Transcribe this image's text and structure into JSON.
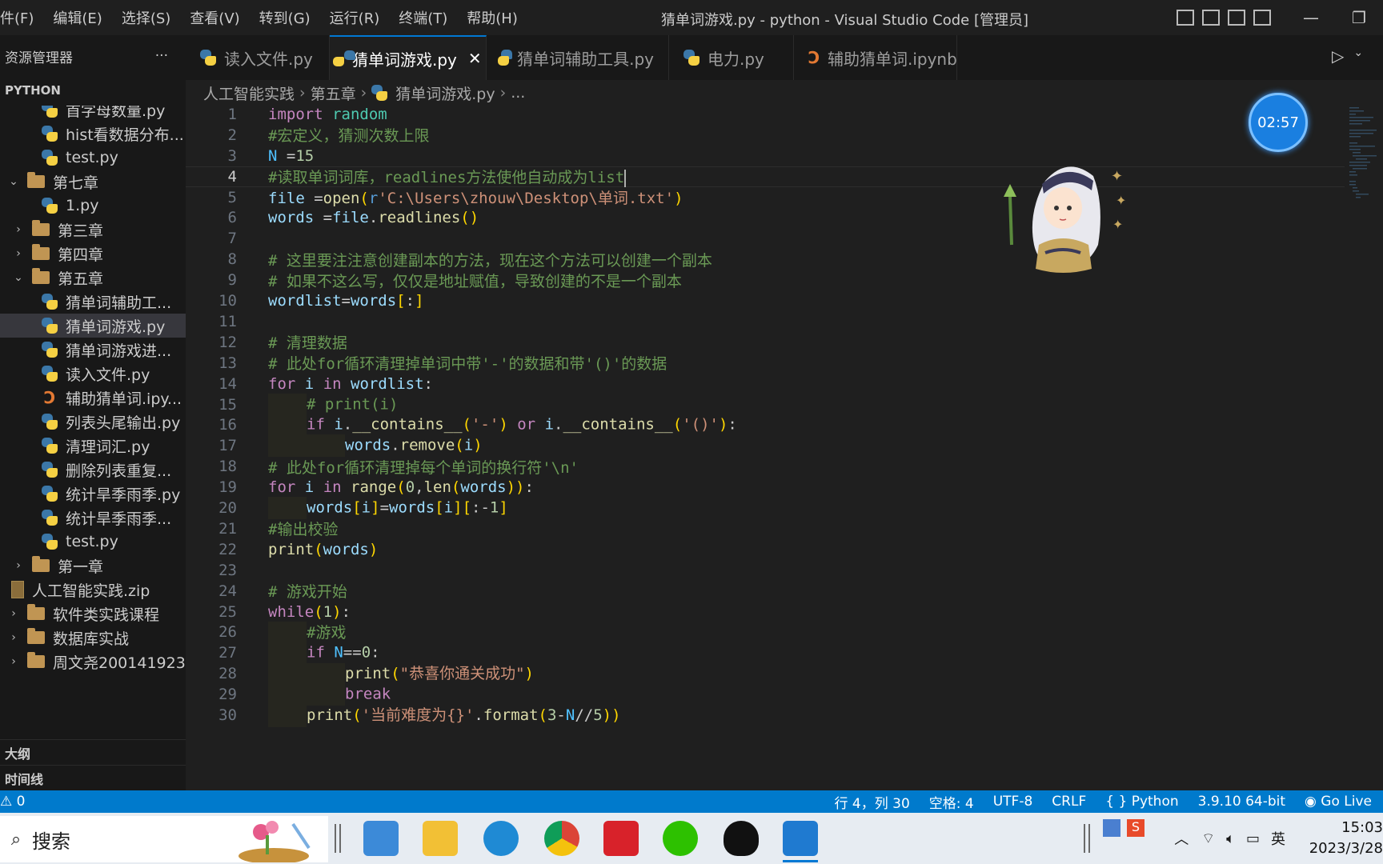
{
  "titlebar": {
    "menus": [
      "件(F)",
      "编辑(E)",
      "选择(S)",
      "查看(V)",
      "转到(G)",
      "运行(R)",
      "终端(T)",
      "帮助(H)"
    ],
    "title": "猜单词游戏.py - python - Visual Studio Code [管理员]"
  },
  "sidebar": {
    "header": "资源管理器",
    "more": "···",
    "section": "PYTHON",
    "items": [
      {
        "label": "首字母数量.py",
        "type": "py"
      },
      {
        "label": "hist看数据分布...",
        "type": "py"
      },
      {
        "label": "test.py",
        "type": "py"
      },
      {
        "label": "第七章",
        "type": "folder",
        "open": true
      },
      {
        "label": "1.py",
        "type": "py"
      },
      {
        "label": "第三章",
        "type": "folder"
      },
      {
        "label": "第四章",
        "type": "folder"
      },
      {
        "label": "第五章",
        "type": "folder",
        "open": true
      },
      {
        "label": "猜单词辅助工...",
        "type": "py"
      },
      {
        "label": "猜单词游戏.py",
        "type": "py",
        "selected": true
      },
      {
        "label": "猜单词游戏进...",
        "type": "py"
      },
      {
        "label": "读入文件.py",
        "type": "py"
      },
      {
        "label": "辅助猜单词.ipy...",
        "type": "nb"
      },
      {
        "label": "列表头尾输出.py",
        "type": "py"
      },
      {
        "label": "清理词汇.py",
        "type": "py"
      },
      {
        "label": "删除列表重复...",
        "type": "py"
      },
      {
        "label": "统计旱季雨季.py",
        "type": "py"
      },
      {
        "label": "统计旱季雨季...",
        "type": "py"
      },
      {
        "label": "test.py",
        "type": "py"
      },
      {
        "label": "第一章",
        "type": "folder"
      },
      {
        "label": "人工智能实践.zip",
        "type": "zip"
      },
      {
        "label": "软件类实践课程",
        "type": "folder"
      },
      {
        "label": "数据库实战",
        "type": "folder"
      },
      {
        "label": "周文尧200141923",
        "type": "folder"
      }
    ],
    "outline": "大纲",
    "timeline": "时间线"
  },
  "tabs": [
    {
      "label": "读入文件.py",
      "type": "py"
    },
    {
      "label": "猜单词游戏.py",
      "type": "py",
      "active": true
    },
    {
      "label": "猜单词辅助工具.py",
      "type": "py"
    },
    {
      "label": "电力.py",
      "type": "py"
    },
    {
      "label": "辅助猜单词.ipynb",
      "type": "nb"
    }
  ],
  "breadcrumb": [
    "人工智能实践",
    "第五章",
    "猜单词游戏.py",
    "..."
  ],
  "editor": {
    "current_line": 4,
    "lines": [
      "import random",
      "#宏定义，猜测次数上限",
      "N =15",
      "#读取单词词库，readlines方法使他自动成为list",
      "file =open(r'C:\\Users\\zhouw\\Desktop\\单词.txt')",
      "words =file.readlines()",
      "",
      "# 这里要注注意创建副本的方法，现在这个方法可以创建一个副本",
      "# 如果不这么写，仅仅是地址赋值，导致创建的不是一个副本",
      "wordlist=words[:]",
      "",
      "# 清理数据",
      "# 此处for循环清理掉单词中带'-'的数据和带'()'的数据",
      "for i in wordlist:",
      "    # print(i)",
      "    if i.__contains__('-') or i.__contains__('()'):",
      "        words.remove(i)",
      "# 此处for循环清理掉每个单词的换行符'\\n'",
      "for i in range(0,len(words)):",
      "    words[i]=words[i][:-1]",
      "#输出校验",
      "print(words)",
      "",
      "# 游戏开始",
      "while(1):",
      "    #游戏",
      "    if N==0:",
      "        print(\"恭喜你通关成功\")",
      "        break",
      "    print('当前难度为{}'.format(3-N//5))"
    ]
  },
  "timer": "02:57",
  "statusbar": {
    "left": "⚠ 0",
    "position": "行 4，列 30",
    "spaces": "空格: 4",
    "encoding": "UTF-8",
    "eol": "CRLF",
    "language": "Python",
    "interpreter": "3.9.10 64-bit",
    "golive": "Go Live"
  },
  "taskbar": {
    "search": "搜索",
    "ime": "英",
    "time": "15:03",
    "date": "2023/3/28"
  }
}
